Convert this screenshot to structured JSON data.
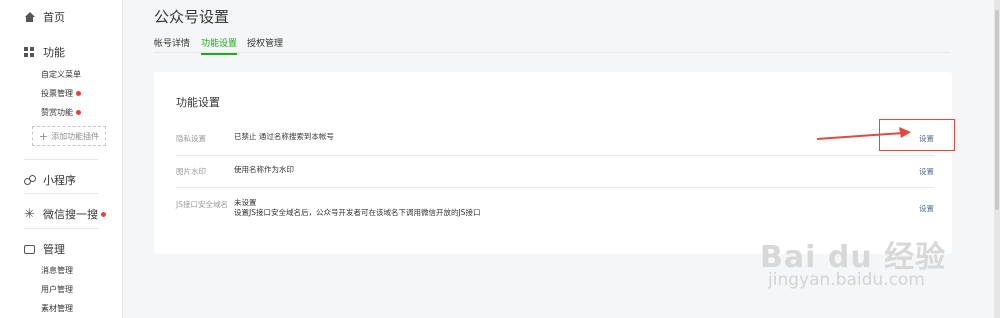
{
  "sidebar": {
    "home": "首页",
    "features": "功能",
    "feature_items": [
      "自定义菜单",
      "投票管理",
      "赞赏功能"
    ],
    "add_plugin": "添加功能插件",
    "mini_program": "小程序",
    "wechat_search": "微信搜一搜",
    "manage": "管理",
    "manage_items": [
      "消息管理",
      "用户管理",
      "素材管理"
    ]
  },
  "page": {
    "title": "公众号设置",
    "tabs": [
      "帐号详情",
      "功能设置",
      "授权管理"
    ],
    "active_tab": "功能设置"
  },
  "card": {
    "title": "功能设置",
    "rows": [
      {
        "label": "隐私设置",
        "value": "已禁止 通过名称搜索到本帐号",
        "action": "设置"
      },
      {
        "label": "图片水印",
        "value": "使用名称作为水印",
        "action": "设置"
      },
      {
        "label": "JS接口安全域名",
        "value": "未设置",
        "value2": "设置JS接口安全域名后，公众号开发者可在该域名下调用微信开放的JS接口",
        "action": "设置"
      }
    ]
  },
  "watermark": {
    "brand": "Bai du 经验",
    "url": "jingyan.baidu.com"
  },
  "colors": {
    "accent_green": "#1aad19",
    "link_blue": "#576b95",
    "red_dot": "#e64340",
    "annotation_red": "#e24a40"
  },
  "icons": {
    "home": "home-icon",
    "features": "grid-icon",
    "mini_program": "mini-program-icon",
    "search": "search-sparkle-icon",
    "manage": "manage-icon",
    "annotation": "red-arrow-annotation"
  }
}
